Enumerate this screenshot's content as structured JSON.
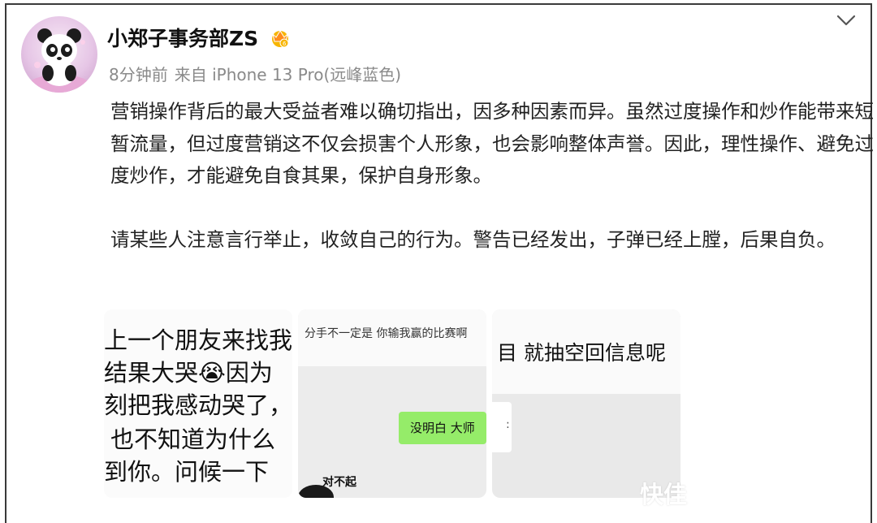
{
  "user": {
    "name": "小郑子事务部ZS",
    "time": "8分钟前",
    "source": "来自 iPhone 13 Pro(远峰蓝色)"
  },
  "post": {
    "paragraph1": "营销操作背后的最大受益者难以确切指出，因多种因素而异。虽然过度操作和炒作能带来短暂流量，但过度营销这不仅会损害个人形象，也会影响整体声誉。因此，理性操作、避免过度炒作，才能避免自食其果，保护自身形象。",
    "paragraph2": "请某些人注意言行举止，收敛自己的行为。警告已经发出，子弹已经上膛，后果自负。"
  },
  "images": [
    {
      "lines": [
        "上一个朋友来找我",
        "结果大哭😭因为",
        "刻把我感动哭了，",
        "也不知道为什么",
        "到你。问候一下"
      ]
    },
    {
      "header": "分手不一定是 你输我赢的比赛啊",
      "bubble": "没明白 大师",
      "caption": "对不起"
    },
    {
      "text": "目 就抽空回信息呢",
      "side": ":"
    }
  ],
  "watermark": "快佳",
  "icons": {
    "menu": "chevron-down-icon",
    "badge": "vip-crown-icon",
    "avatar": "panda-avatar"
  }
}
